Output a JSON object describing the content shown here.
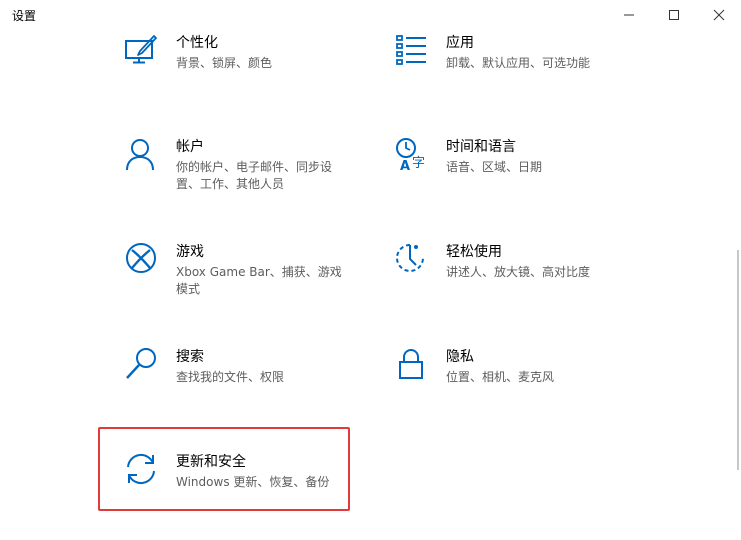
{
  "window": {
    "title": "设置"
  },
  "colors": {
    "accent": "#0067c0",
    "highlight_border": "#e03a3a"
  },
  "tiles": [
    {
      "name": "个性化",
      "desc": "背景、锁屏、颜色",
      "icon": "personalization-icon"
    },
    {
      "name": "应用",
      "desc": "卸载、默认应用、可选功能",
      "icon": "apps-icon"
    },
    {
      "name": "帐户",
      "desc": "你的帐户、电子邮件、同步设置、工作、其他人员",
      "icon": "accounts-icon"
    },
    {
      "name": "时间和语言",
      "desc": "语音、区域、日期",
      "icon": "time-language-icon"
    },
    {
      "name": "游戏",
      "desc": "Xbox Game Bar、捕获、游戏模式",
      "icon": "gaming-icon"
    },
    {
      "name": "轻松使用",
      "desc": "讲述人、放大镜、高对比度",
      "icon": "ease-of-access-icon"
    },
    {
      "name": "搜索",
      "desc": "查找我的文件、权限",
      "icon": "search-icon"
    },
    {
      "name": "隐私",
      "desc": "位置、相机、麦克风",
      "icon": "privacy-lock-icon"
    },
    {
      "name": "更新和安全",
      "desc": "Windows 更新、恢复、备份",
      "icon": "update-sync-icon"
    }
  ]
}
